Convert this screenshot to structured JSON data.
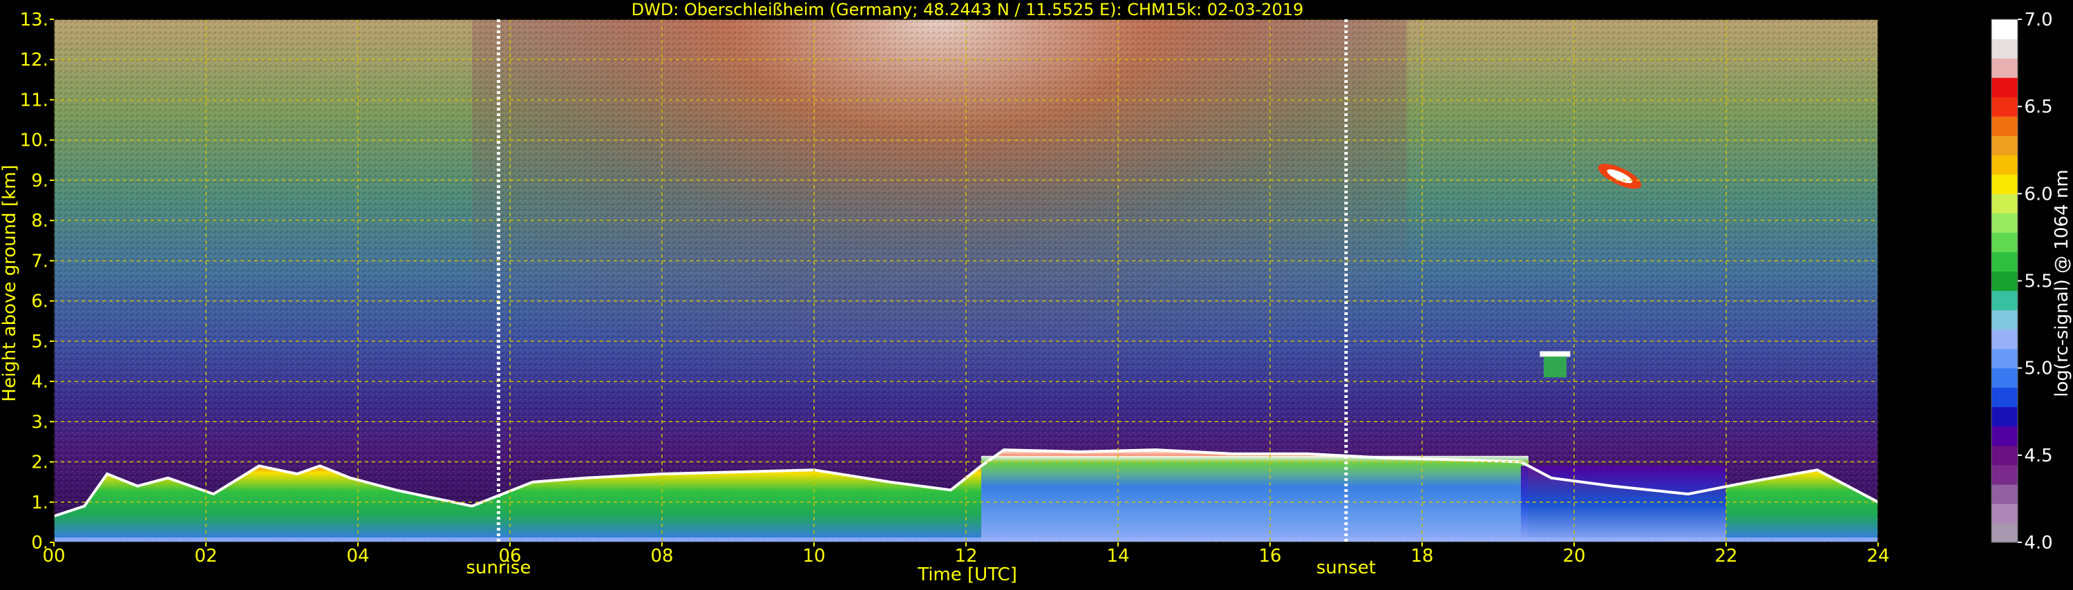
{
  "chart_data": {
    "type": "heatmap",
    "title": "DWD: Oberschleißheim (Germany; 48.2443 N / 11.5525 E):    CHM15k: 02-03-2019",
    "xlabel": "Time [UTC]",
    "ylabel": "Height above ground [km]",
    "x_ticks": [
      "00",
      "02",
      "04",
      "06",
      "08",
      "10",
      "12",
      "14",
      "16",
      "18",
      "20",
      "22",
      "24"
    ],
    "x_range": [
      0,
      24
    ],
    "y_ticks": [
      "0.",
      "1.",
      "2.",
      "3.",
      "4.",
      "5.",
      "6.",
      "7.",
      "8.",
      "9.",
      "10.",
      "11.",
      "12.",
      "13."
    ],
    "y_range": [
      0,
      13
    ],
    "grid": true,
    "colorbar": {
      "label": "log(rc-signal) @ 1064 nm",
      "ticks": [
        "4.0",
        "4.5",
        "5.0",
        "5.5",
        "6.0",
        "6.5",
        "7.0"
      ],
      "range": [
        4.0,
        7.0
      ],
      "colors": [
        "#a898b0",
        "#b088b8",
        "#9060a0",
        "#7a2a8a",
        "#6a1080",
        "#5000a0",
        "#1a10b8",
        "#1848e0",
        "#3878f0",
        "#6898f8",
        "#98b0f8",
        "#80c8e0",
        "#38c0a0",
        "#18a030",
        "#30c040",
        "#60d850",
        "#98e860",
        "#d0f050",
        "#f8e800",
        "#f8c000",
        "#f0a020",
        "#f07010",
        "#f03010",
        "#e81010",
        "#e8b0b0",
        "#e8e0e0",
        "#ffffff"
      ]
    },
    "markers": [
      {
        "label": "sunrise",
        "x": 5.85
      },
      {
        "label": "sunset",
        "x": 17.0
      }
    ],
    "colors": {
      "text": "#ffff00",
      "grid": "#d4c000",
      "marker": "#ffffff",
      "background": "#000000"
    }
  }
}
